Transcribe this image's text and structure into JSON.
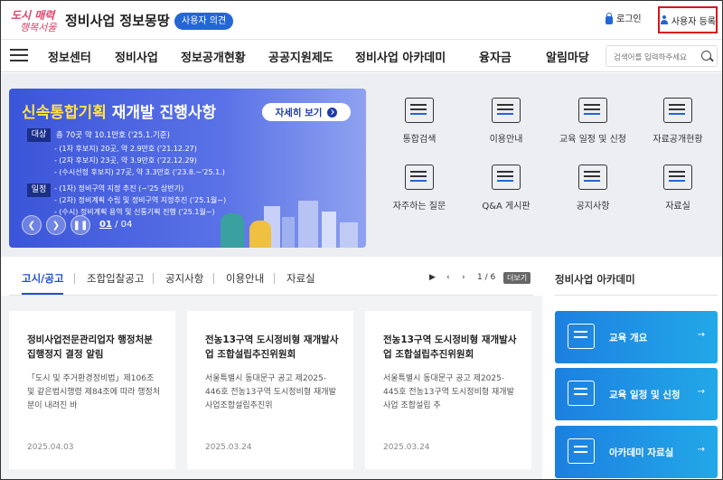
{
  "header": {
    "logo_line1": "도시 매력",
    "logo_line2": "행복서울",
    "site_title": "정비사업 정보몽땅",
    "user_opinion": "사용자 의견",
    "login": "로그인",
    "register": "사용자 등록"
  },
  "nav": {
    "items": [
      "정보센터",
      "정비사업",
      "정보공개현황",
      "공공지원제도",
      "정비사업 아카데미",
      "융자금",
      "알림마당"
    ],
    "search_placeholder": "검색어를 입력하주세요"
  },
  "banner": {
    "title_highlight": "신속통합기획",
    "title_rest": " 재개발 진행사항",
    "detail_button": "자세히 보기",
    "tag_target": "대상",
    "target_summary": "총 70곳 약 10.1만호 ('25.1.기준)",
    "target_items": [
      "- (1차 후보지) 20곳, 약 2.9만호 ('21.12.27)",
      "- (2차 후보지) 23곳, 약 3.9만호 ('22.12.29)",
      "- (수시선정 후보지) 27곳, 약 3.3만호 ('23.8.~'25.1.)"
    ],
    "tag_schedule": "일정",
    "schedule_items": [
      "- (1차) 정비구역 지정 추진 (~'25 상반기)",
      "- (2차) 정비계획 수립 및 정비구역 지정추진 ('25.1월~)",
      "- (수시) 정비계획 용역 및 신통기획 진행 ('25.1월~)"
    ],
    "current_slide": "01",
    "slide_separator": "/",
    "total_slides": "04"
  },
  "quick_links": [
    "통합검색",
    "이용안내",
    "교육 일정 및 신청",
    "자료공개현황",
    "자주하는 질문",
    "Q&A 게시판",
    "공지사항",
    "자료실"
  ],
  "notice": {
    "tabs": [
      "고시/공고",
      "조합입찰공고",
      "공지사항",
      "이용안내",
      "자료실"
    ],
    "pager": "1 / 6",
    "more": "더보기",
    "cards": [
      {
        "title": "정비사업전문관리업자 행정처분 집행정지 결정 알림",
        "desc": "「도시 및 주거환경정비법」제106조 및 같은법시행령 제84조에 따라 행정처분이 내려진 바",
        "date": "2025.04.03"
      },
      {
        "title": "전농13구역 도시정비형 재개발사업 조합설립추진위원회",
        "desc": "서울특별시 동대문구 공고 제2025-446호 전농13구역 도시정비형 재개발사업조합설립추진위",
        "date": "2025.03.24"
      },
      {
        "title": "전농13구역 도시정비형 재개발사업 조합설립추진위원회",
        "desc": "서울특별시 동대문구 공고 제2025-445호 전농13구역 도시정비형 재개발사업 조합설립 추",
        "date": "2025.03.24"
      }
    ]
  },
  "academy": {
    "title": "정비사업 아카데미",
    "items": [
      "교육 개요",
      "교육 일정 및 신청",
      "아카데미 자료실"
    ]
  },
  "colors": {
    "primary": "#2466d6",
    "highlight": "#d8141c",
    "banner_yellow": "#ffe14d"
  }
}
